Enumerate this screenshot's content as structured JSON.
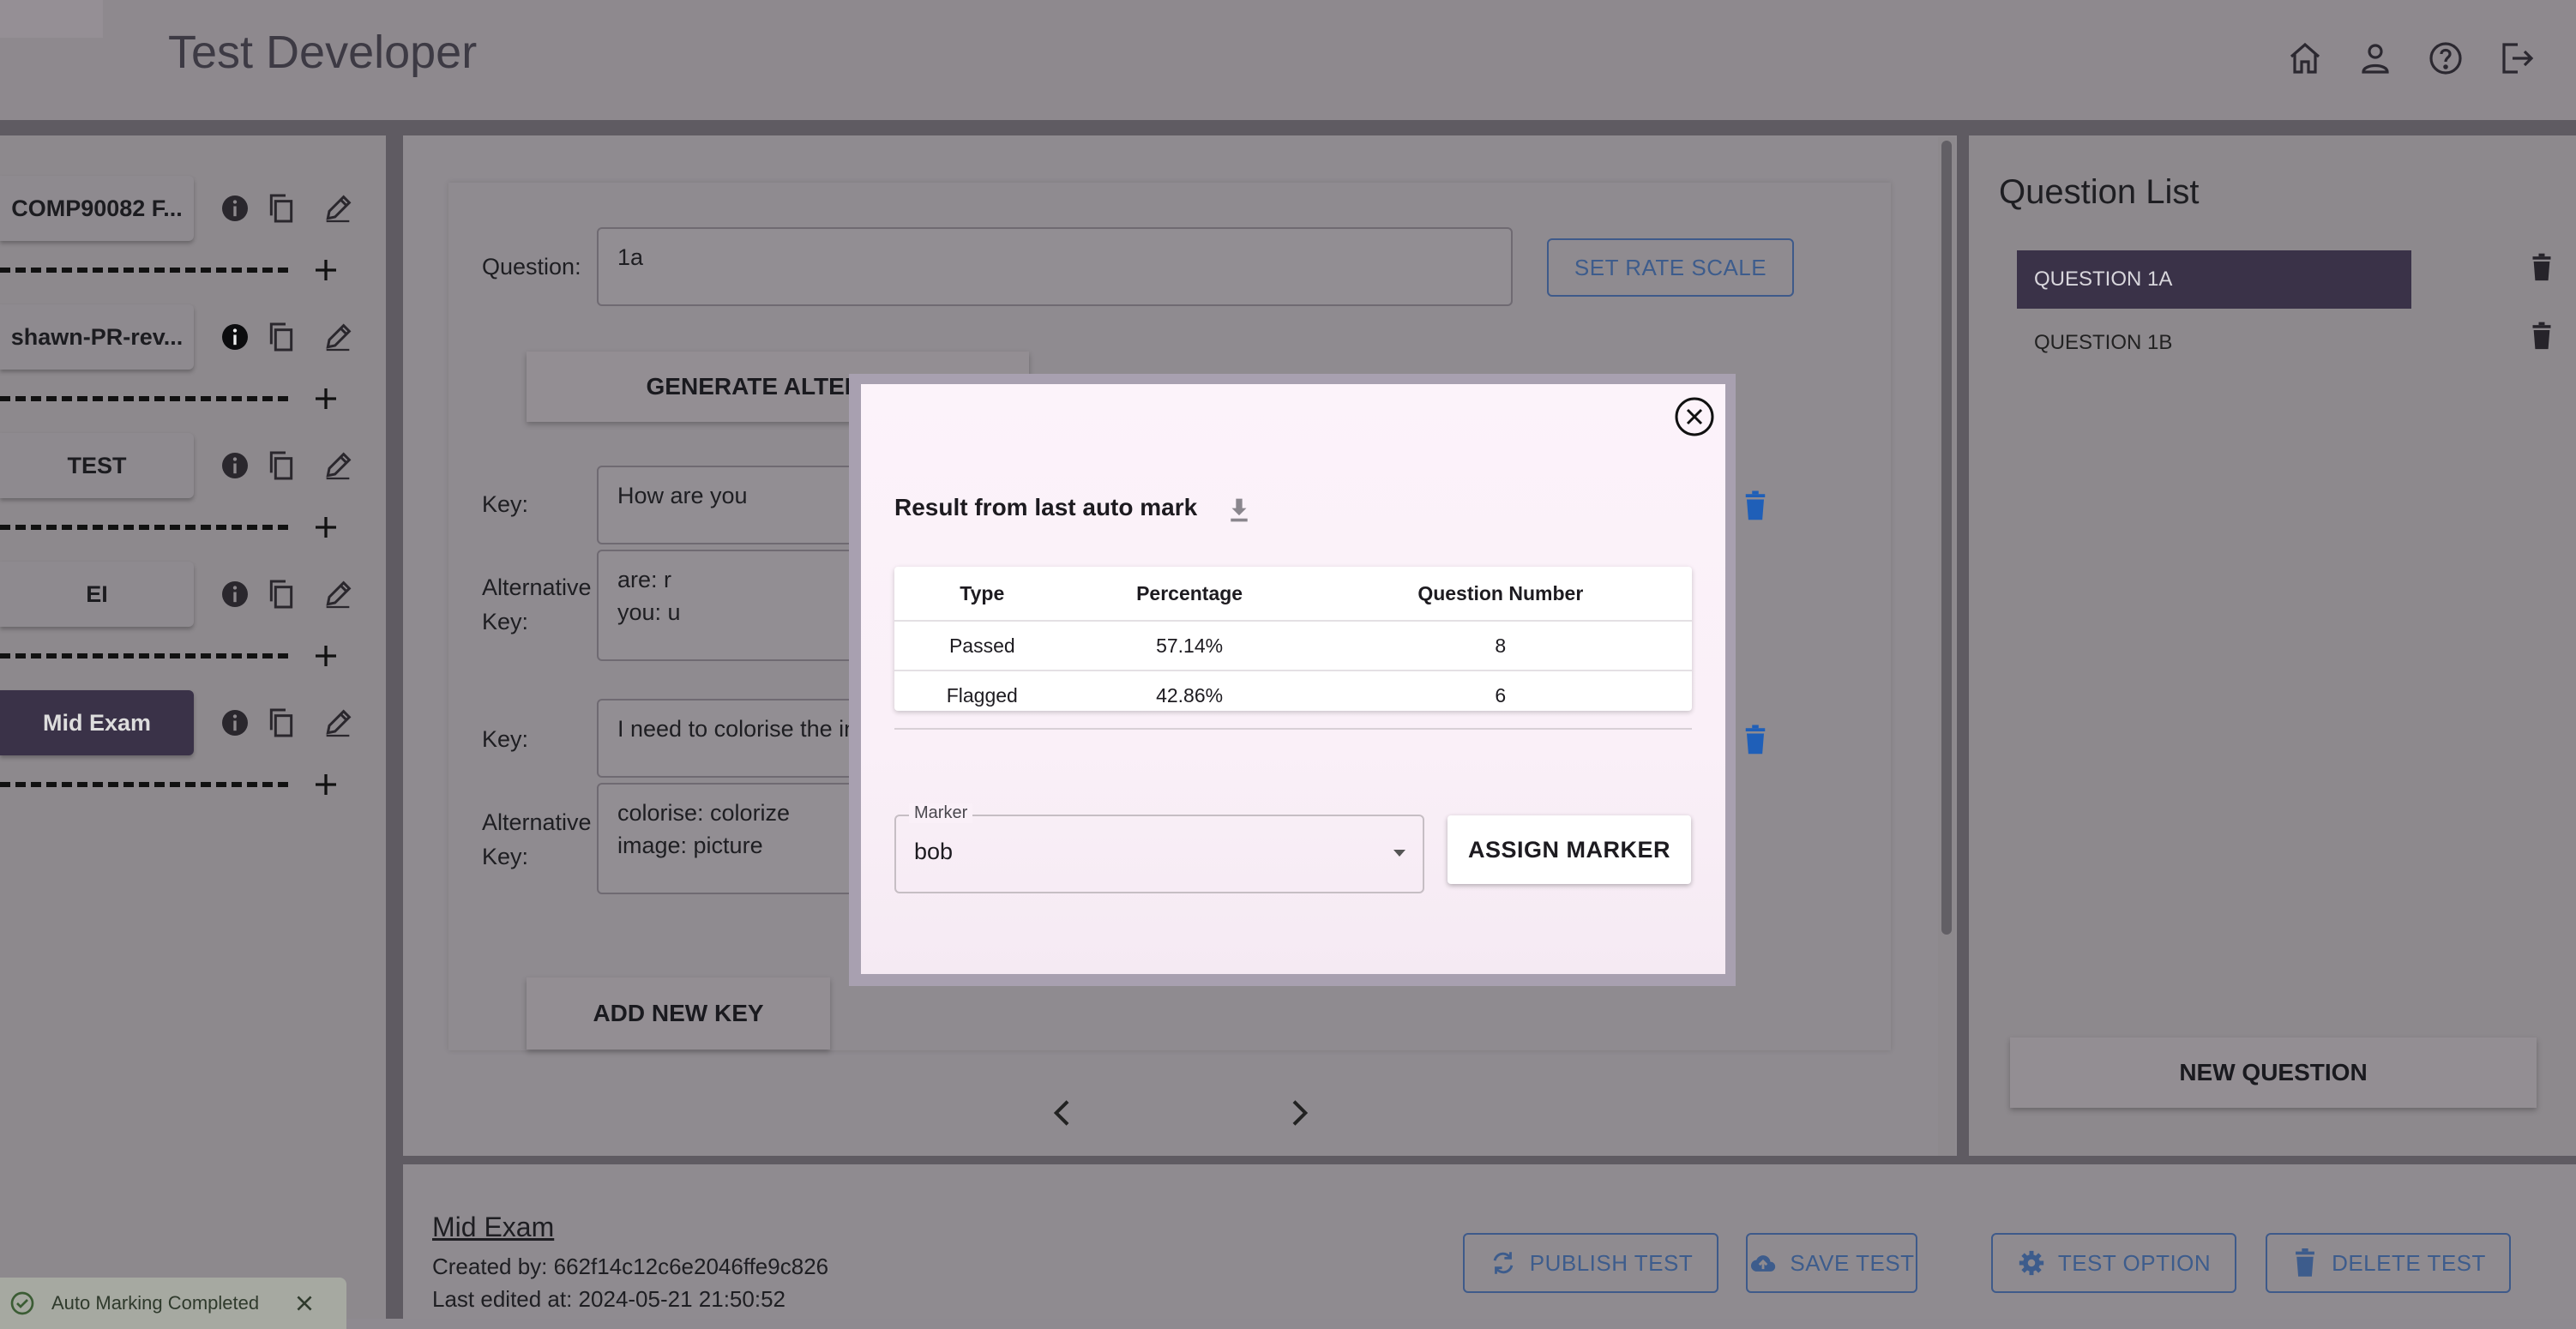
{
  "header": {
    "title": "Test Developer",
    "icons": [
      "home-icon",
      "user-icon",
      "help-icon",
      "logout-icon"
    ]
  },
  "sidebar": {
    "tests": [
      {
        "label": "COMP90082 F...",
        "active": false
      },
      {
        "label": "shawn-PR-rev...",
        "active": false
      },
      {
        "label": "TEST",
        "active": false
      },
      {
        "label": "EI",
        "active": false
      },
      {
        "label": "Mid Exam",
        "active": true
      }
    ]
  },
  "editor": {
    "question_label": "Question:",
    "question_value": "1a",
    "set_rate_scale": "SET RATE SCALE",
    "generate_alternative": "GENERATE ALTERNAT",
    "keys": [
      {
        "key_label": "Key:",
        "key_value": "How are you",
        "alt_label_1": "Alternative",
        "alt_label_2": "Key:",
        "alt_line_1": "are: r",
        "alt_line_2": "you: u"
      },
      {
        "key_label": "Key:",
        "key_value": "I need to colorise the in",
        "alt_label_1": "Alternative",
        "alt_label_2": "Key:",
        "alt_line_1": "colorise: colorize",
        "alt_line_2": "image: picture"
      }
    ],
    "add_new_key": "ADD NEW KEY"
  },
  "question_list": {
    "title": "Question List",
    "items": [
      {
        "label": "QUESTION 1A",
        "active": true
      },
      {
        "label": "QUESTION 1B",
        "active": false
      }
    ],
    "new_question": "NEW QUESTION"
  },
  "footer": {
    "exam_name": "Mid Exam",
    "created_by": "Created by: 662f14c12c6e2046ffe9c826",
    "last_edited": "Last edited at: 2024-05-21 21:50:52",
    "buttons": {
      "publish": "PUBLISH TEST",
      "save": "SAVE TEST",
      "option": "TEST OPTION",
      "delete": "DELETE TEST"
    }
  },
  "toast": {
    "message": "Auto Marking Completed"
  },
  "modal": {
    "title": "Result from last auto mark",
    "table": {
      "headers": [
        "Type",
        "Percentage",
        "Question Number"
      ],
      "rows": [
        [
          "Passed",
          "57.14%",
          "8"
        ],
        [
          "Flagged",
          "42.86%",
          "6"
        ]
      ]
    },
    "marker_label": "Marker",
    "marker_value": "bob",
    "assign_button": "ASSIGN MARKER"
  },
  "colors": {
    "accent_dark": "#3a3248",
    "link_blue": "#3d5c8c",
    "trash_blue": "#1f5fb8"
  }
}
